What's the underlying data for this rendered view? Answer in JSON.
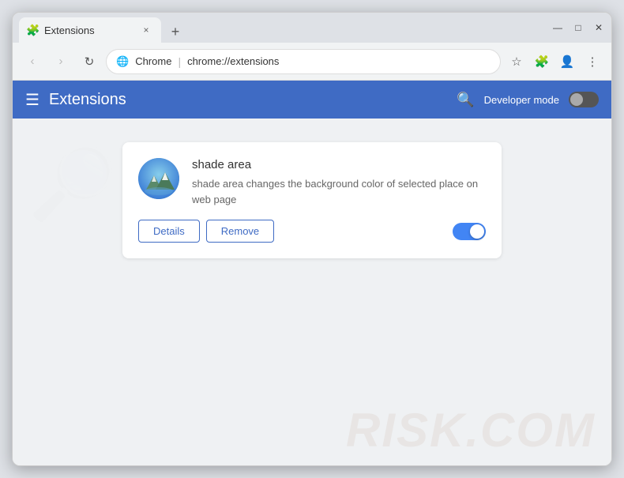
{
  "browser": {
    "tab": {
      "favicon": "🧩",
      "title": "Extensions",
      "close_label": "×"
    },
    "new_tab_label": "+",
    "window_controls": {
      "minimize": "—",
      "maximize": "□",
      "close": "✕"
    },
    "nav": {
      "back_label": "‹",
      "forward_label": "›",
      "reload_label": "↻",
      "site_label": "Chrome",
      "address": "chrome://extensions",
      "address_display_chrome": "chrome://",
      "address_display_path": "extensions"
    },
    "toolbar": {
      "star_label": "☆",
      "extensions_label": "🧩",
      "profile_label": "👤",
      "menu_label": "⋮"
    }
  },
  "extensions_page": {
    "header": {
      "menu_icon": "☰",
      "title": "Extensions",
      "search_icon": "🔍",
      "dev_mode_label": "Developer mode"
    },
    "extension": {
      "name": "shade area",
      "description": "shade area changes the background color of selected place on web page",
      "details_btn": "Details",
      "remove_btn": "Remove",
      "enabled": true
    }
  },
  "watermark": {
    "top": "🔍",
    "bottom": "RISK.COM"
  }
}
